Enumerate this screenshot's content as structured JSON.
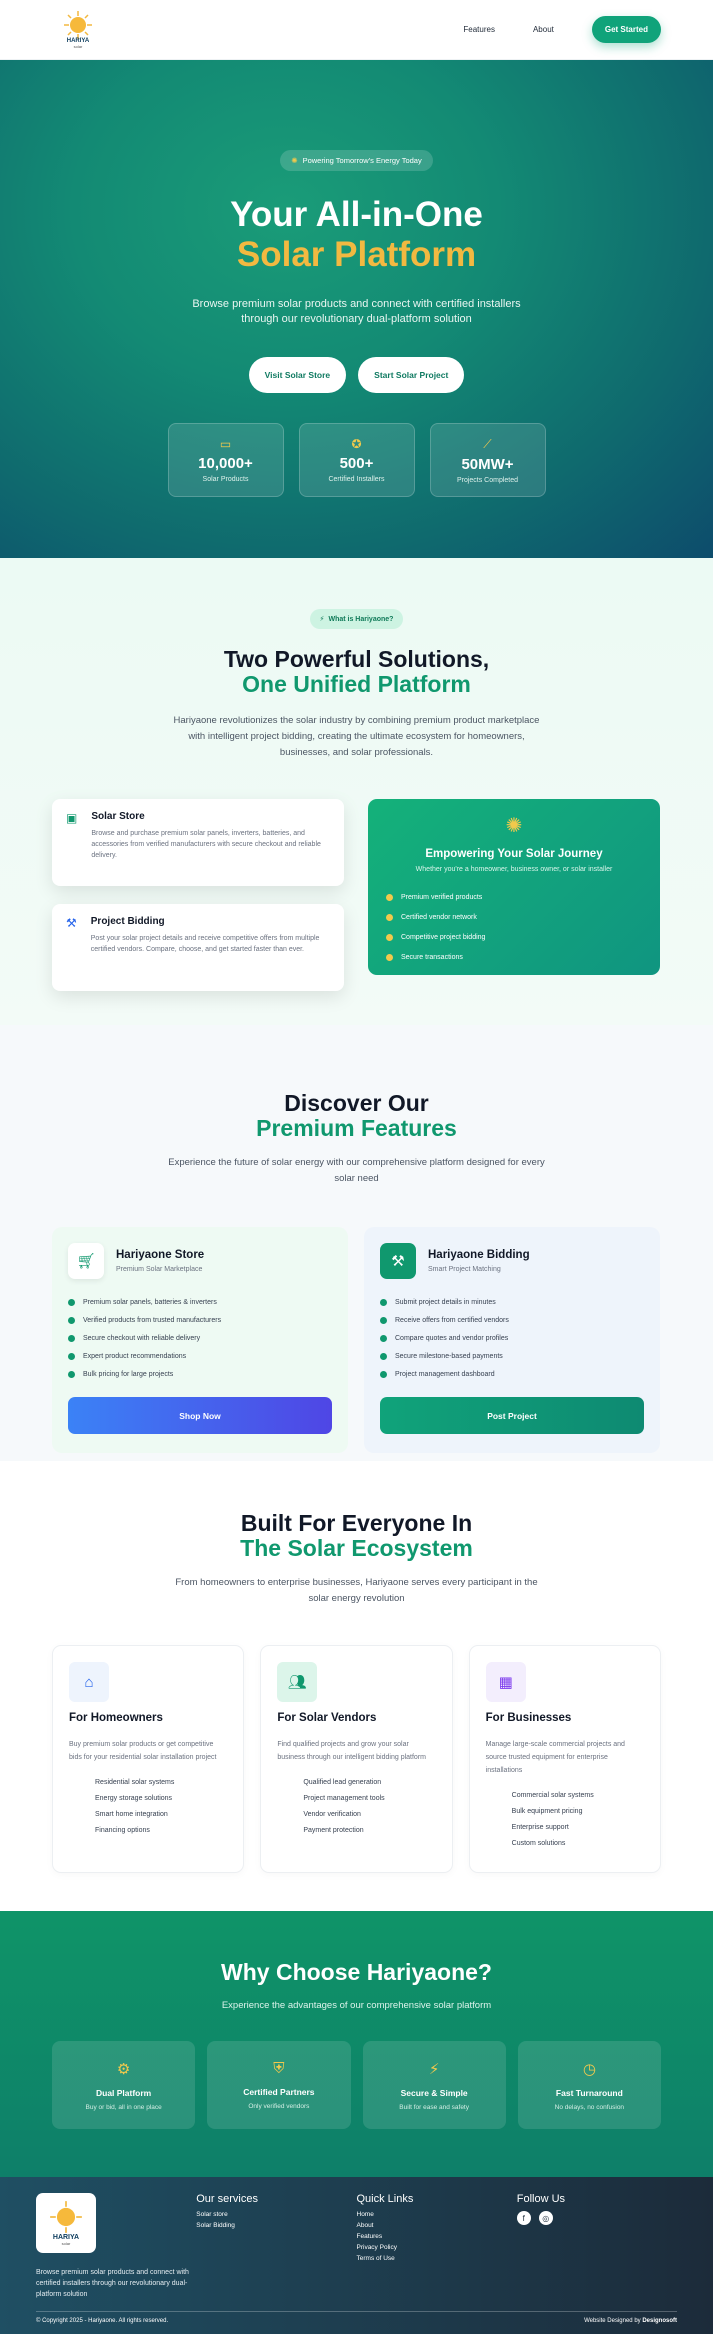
{
  "header": {
    "brand": "HARIYA",
    "brand_sub": "solar",
    "nav": [
      "Features",
      "About"
    ],
    "cta": "Get Started"
  },
  "hero": {
    "pill": "Powering Tomorrow's Energy Today",
    "title1": "Your All-in-One",
    "title2": "Solar Platform",
    "subtitle": "Browse premium solar products and connect with certified installers through our revolutionary dual-platform solution",
    "btn1": "Visit Solar Store",
    "btn2": "Start Solar Project",
    "stats": [
      {
        "value": "10,000+",
        "label": "Solar Products",
        "icon": "battery-icon"
      },
      {
        "value": "500+",
        "label": "Certified Installers",
        "icon": "award-icon"
      },
      {
        "value": "50MW+",
        "label": "Projects Completed",
        "icon": "chart-icon"
      }
    ]
  },
  "solutions": {
    "tag": "What is Hariyaone?",
    "title1": "Two Powerful Solutions,",
    "title2": "One Unified Platform",
    "subtitle": "Hariyaone revolutionizes the solar industry by combining premium product marketplace with intelligent project bidding, creating the ultimate ecosystem for homeowners, businesses, and solar professionals.",
    "cards": [
      {
        "title": "Solar Store",
        "desc": "Browse and purchase premium solar panels, inverters, batteries, and accessories from verified manufacturers with secure checkout and reliable delivery."
      },
      {
        "title": "Project Bidding",
        "desc": "Post your solar project details and receive competitive offers from multiple certified vendors. Compare, choose, and get started faster than ever."
      }
    ],
    "journey": {
      "title": "Empowering Your Solar Journey",
      "subtitle": "Whether you're a homeowner, business owner, or solar installer",
      "items": [
        "Premium verified products",
        "Certified vendor network",
        "Competitive project bidding",
        "Secure transactions"
      ]
    }
  },
  "features": {
    "title1": "Discover Our",
    "title2": "Premium Features",
    "subtitle": "Experience the future of solar energy with our comprehensive platform designed for every solar need",
    "cards": [
      {
        "title": "Hariyaone Store",
        "sub": "Premium Solar Marketplace",
        "items": [
          "Premium solar panels, batteries & inverters",
          "Verified products from trusted manufacturers",
          "Secure checkout with reliable delivery",
          "Expert product recommendations",
          "Bulk pricing for large projects"
        ],
        "btn": "Shop Now"
      },
      {
        "title": "Hariyaone Bidding",
        "sub": "Smart Project Matching",
        "items": [
          "Submit project details in minutes",
          "Receive offers from certified vendors",
          "Compare quotes and vendor profiles",
          "Secure milestone-based payments",
          "Project management dashboard"
        ],
        "btn": "Post Project"
      }
    ]
  },
  "ecosystem": {
    "title1": "Built For Everyone In",
    "title2": "The Solar Ecosystem",
    "subtitle": "From homeowners to enterprise businesses, Hariyaone serves every participant in the solar energy revolution",
    "cards": [
      {
        "title": "For Homeowners",
        "desc": "Buy premium solar products or get competitive bids for your residential solar installation project",
        "items": [
          "Residential solar systems",
          "Energy storage solutions",
          "Smart home integration",
          "Financing options"
        ]
      },
      {
        "title": "For Solar Vendors",
        "desc": "Find qualified projects and grow your solar business through our intelligent bidding platform",
        "items": [
          "Qualified lead generation",
          "Project management tools",
          "Vendor verification",
          "Payment protection"
        ]
      },
      {
        "title": "For Businesses",
        "desc": "Manage large-scale commercial projects and source trusted equipment for enterprise installations",
        "items": [
          "Commercial solar systems",
          "Bulk equipment pricing",
          "Enterprise support",
          "Custom solutions"
        ]
      }
    ]
  },
  "why": {
    "title": "Why Choose Hariyaone?",
    "subtitle": "Experience the advantages of our comprehensive solar platform",
    "cards": [
      {
        "title": "Dual Platform",
        "desc": "Buy or bid, all in one place"
      },
      {
        "title": "Certified Partners",
        "desc": "Only verified vendors"
      },
      {
        "title": "Secure & Simple",
        "desc": "Built for ease and safety"
      },
      {
        "title": "Fast Turnaround",
        "desc": "No delays, no confusion"
      }
    ]
  },
  "footer": {
    "brand": "HARIYA",
    "brand_sub": "solar",
    "desc": "Browse premium solar products and connect with certified installers through our revolutionary dual-platform solution",
    "services_title": "Our services",
    "services": [
      "Solar store",
      "Solar Bidding"
    ],
    "links_title": "Quick Links",
    "links": [
      "Home",
      "About",
      "Features",
      "Privacy Policy",
      "Terms of Use"
    ],
    "follow_title": "Follow Us",
    "copyright": "© Copyright 2025 - Hariyaone. All rights reserved.",
    "designed_prefix": "Website Designed by",
    "designed_by": "Designosoft"
  },
  "colors": {
    "green": "#10986e",
    "yellow": "#f2b941",
    "blue": "#4f5fe0",
    "dark": "#1c2b3a"
  }
}
